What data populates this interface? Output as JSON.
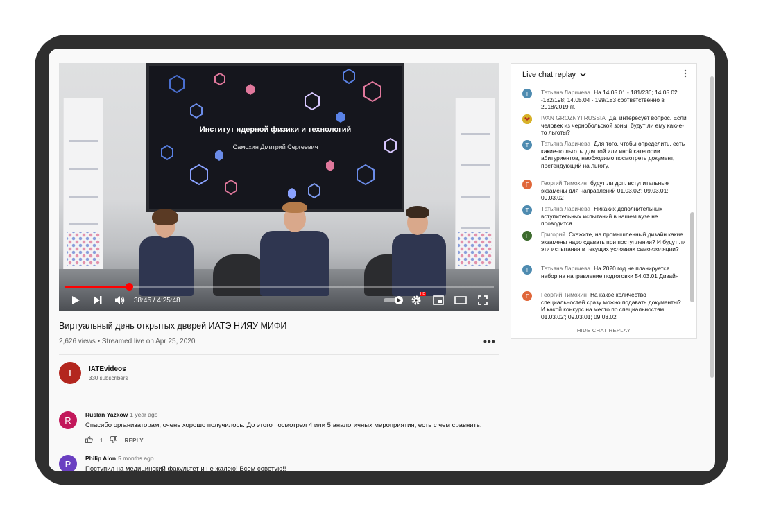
{
  "video": {
    "slide_title": "Институт ядерной физики и технологий",
    "slide_subtitle": "Самохин Дмитрий Сергеевич",
    "time_display": "38:45 / 4:25:48",
    "progress_fraction": 0.15,
    "hd_badge": "HD"
  },
  "meta": {
    "title": "Виртуальный день открытых дверей ИАТЭ НИЯУ МИФИ",
    "stats": "2,626 views • Streamed live on Apr 25, 2020",
    "more": "•••"
  },
  "channel": {
    "initial": "I",
    "name": "IATEvideos",
    "subscribers": "330 subscribers",
    "avatar_color": "#b3261e"
  },
  "comments": [
    {
      "initial": "R",
      "color": "#c2185b",
      "author": "Ruslan Yazkow",
      "time": "1 year ago",
      "text": "Спасибо организаторам, очень хорошо получилось. До этого посмотрел 4 или 5 аналогичных мероприятия, есть с чем сравнить.",
      "likes": "1",
      "reply": "REPLY"
    },
    {
      "initial": "P",
      "color": "#6a3fc1",
      "author": "Philip Alon",
      "time": "5 months ago",
      "text": "Поступил на медицинский факультет и не жалею! Всем советую!!"
    }
  ],
  "chat": {
    "header": "Live chat replay",
    "footer": "HIDE CHAT REPLAY",
    "messages": [
      {
        "initial": "Т",
        "color": "#4e8bb0",
        "author": "Татьяна Ларичева",
        "text": "На 14.05.01 - 181/236; 14.05.02 -182/198; 14.05.04 - 199/183 соответственно в 2018/2019 гг."
      },
      {
        "initial": "",
        "color": "#c9b02a",
        "author": "IVAN GROZNYI RUSSIA",
        "text": "Да, интересует вопрос. Если человек из чернобольской зоны, будут ли ему какие-то льготы?"
      },
      {
        "initial": "Т",
        "color": "#4e8bb0",
        "author": "Татьяна Ларичева",
        "text": "Для того, чтобы определить, есть какие-то льготы для той или иной категории абитуриентов, необходимо посмотреть документ, претендующий на льготу."
      },
      {
        "initial": "Г",
        "color": "#e0673a",
        "author": "Георгий Тимохин",
        "text": "будут ли доп. вступительные экзамены для направлений 01.03.02'; 09.03.01; 09.03.02"
      },
      {
        "initial": "Т",
        "color": "#4e8bb0",
        "author": "Татьяна Ларичева",
        "text": "Никаких дополнительных вступительных испытаний в нашем вузе не проводится"
      },
      {
        "initial": "Г",
        "color": "#3d6b2e",
        "author": "Григорий",
        "text": "Скажите, на промышленный дизайн какие экзамены надо сдавать при поступлении? И будут ли эти испытания в текущих условиях самоизоляции?"
      },
      {
        "initial": "Т",
        "color": "#4e8bb0",
        "author": "Татьяна Ларичева",
        "text": "На 2020 год не планируется набор на направление подготовки 54.03.01 Дизайн"
      },
      {
        "initial": "Г",
        "color": "#e0673a",
        "author": "Георгий Тимохин",
        "text": "На какое количество специальностей сразу можно подавать документы? И какой конкурс на место по специальностям 01.03.02'; 09.03.01; 09.03.02"
      }
    ]
  }
}
